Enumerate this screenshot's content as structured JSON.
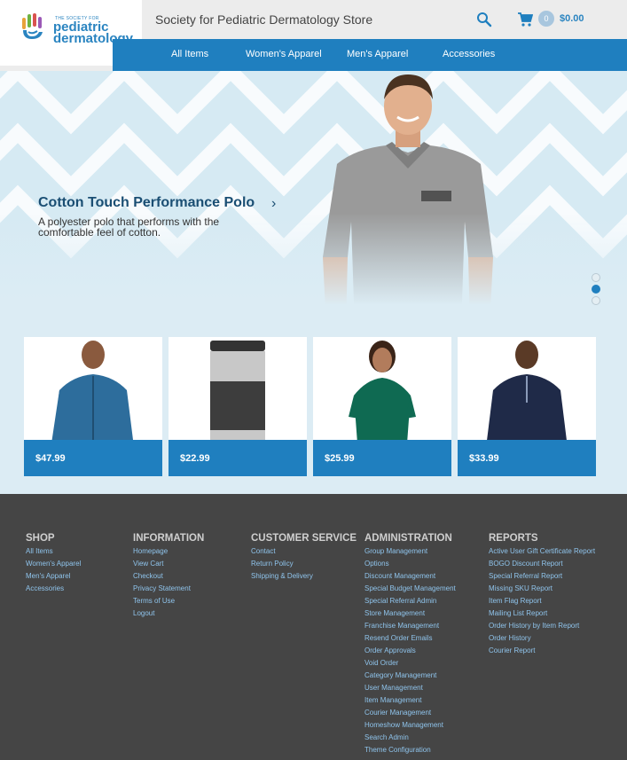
{
  "brand": {
    "logo_small": "THE SOCIETY FOR",
    "logo_line1": "pediatric",
    "logo_line2": "dermatology"
  },
  "header": {
    "store_title": "Society for Pediatric Dermatology Store",
    "cart_count": "0",
    "cart_total": "$0.00",
    "icons": [
      "search-icon",
      "cart-icon"
    ]
  },
  "nav": {
    "items": [
      "All Items",
      "Women's Apparel",
      "Men's Apparel",
      "Accessories"
    ]
  },
  "hero": {
    "title": "Cotton Touch Performance Polo",
    "description": "A polyester polo that performs with the comfortable feel of cotton.",
    "slides": 3,
    "active_slide": 2
  },
  "products": [
    {
      "price": "$47.99"
    },
    {
      "price": "$22.99"
    },
    {
      "price": "$25.99"
    },
    {
      "price": "$33.99"
    }
  ],
  "footer": {
    "columns": [
      {
        "heading": "SHOP",
        "links": [
          "All Items",
          "Women's Apparel",
          "Men's Apparel",
          "Accessories"
        ]
      },
      {
        "heading": "INFORMATION",
        "links": [
          "Homepage",
          "View Cart",
          "Checkout",
          "Privacy Statement",
          "Terms of Use",
          "Logout"
        ]
      },
      {
        "heading": "CUSTOMER SERVICE",
        "links": [
          "Contact",
          "Return Policy",
          "Shipping & Delivery"
        ]
      },
      {
        "heading": "ADMINISTRATION",
        "links": [
          "Group Management",
          "Options",
          "Discount Management",
          "Special Budget Management",
          "Special Referral Admin",
          "Store Management",
          "Franchise Management",
          "Resend Order Emails",
          "Order Approvals",
          "Void Order",
          "Category Management",
          "User Management",
          "Item Management",
          "Courier Management",
          "Homeshow Management",
          "Search Admin",
          "Theme Configuration"
        ]
      },
      {
        "heading": "REPORTS",
        "links": [
          "Active User Gift Certificate Report",
          "BOGO Discount Report",
          "Special Referral Report",
          "Missing SKU Report",
          "Item Flag Report",
          "Mailing List Report",
          "Order History by Item Report",
          "Order History",
          "Courier Report"
        ]
      }
    ]
  },
  "colors": {
    "accent": "#1f7fbf",
    "footer_bg": "#454545",
    "footer_link": "#8fc4ec",
    "hero_bg": "#d6eaf3"
  }
}
